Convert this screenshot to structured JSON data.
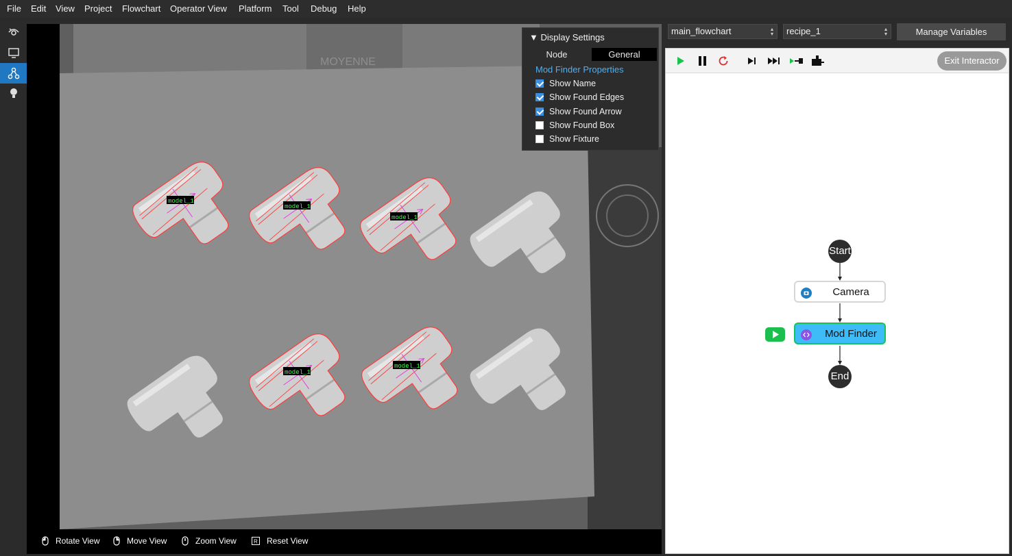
{
  "menu": [
    "File",
    "Edit",
    "View",
    "Project",
    "Flowchart",
    "Operator View",
    "Platform",
    "Tool",
    "Debug",
    "Help"
  ],
  "sidebar": {
    "items": [
      {
        "icon": "eye-icon",
        "active": false
      },
      {
        "icon": "monitor-icon",
        "active": false
      },
      {
        "icon": "flowchart-icon",
        "active": true
      },
      {
        "icon": "lightbulb-icon",
        "active": false
      }
    ]
  },
  "viewer": {
    "box_text": "MOYENNE",
    "detections": [
      "model_1",
      "model_1",
      "model_1",
      "model_1",
      "model_1"
    ],
    "toolbar": [
      {
        "icon": "mouse-left-icon",
        "label": "Rotate View"
      },
      {
        "icon": "mouse-right-icon",
        "label": "Move View"
      },
      {
        "icon": "mouse-wheel-icon",
        "label": "Zoom View"
      },
      {
        "icon": "reset-key-icon",
        "label": "Reset View"
      }
    ]
  },
  "display_settings": {
    "title": "Display Settings",
    "tabs": [
      {
        "label": "Node",
        "active": false
      },
      {
        "label": "General",
        "active": true
      }
    ],
    "section": "Mod Finder Properties",
    "options": [
      {
        "label": "Show Name",
        "checked": true
      },
      {
        "label": "Show Found Edges",
        "checked": true
      },
      {
        "label": "Show Found Arrow",
        "checked": true
      },
      {
        "label": "Show Found Box",
        "checked": false
      },
      {
        "label": "Show Fixture",
        "checked": false
      }
    ]
  },
  "flowchart_select": {
    "value": "main_flowchart"
  },
  "recipe_select": {
    "value": "recipe_1"
  },
  "manage_variables": "Manage Variables",
  "flow_toolbar": {
    "buttons": [
      "play-icon",
      "pause-icon",
      "restart-icon",
      "step-over-icon",
      "step-all-icon",
      "step-into-icon",
      "breakpoint-icon"
    ],
    "exit_label": "Exit Interactor"
  },
  "flowchart": {
    "start": "Start",
    "end": "End",
    "nodes": [
      {
        "label": "Camera",
        "icon": "camera-icon",
        "selected": false
      },
      {
        "label": "Mod Finder",
        "icon": "code-icon",
        "selected": true
      }
    ]
  },
  "colors": {
    "accent": "#1f78c1",
    "link": "#4fb0f0",
    "selected_node": "#3dbcf7",
    "selected_border": "#14c45a",
    "run": "#1bbf4d",
    "edge": "#ff3b3b",
    "arrow": "#e040e0",
    "label_text": "#39ff4a"
  }
}
